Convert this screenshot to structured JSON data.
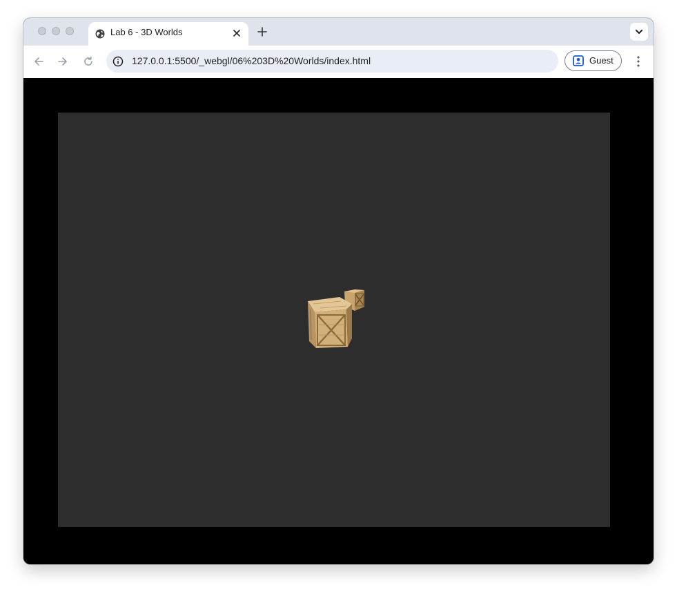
{
  "browser": {
    "tab": {
      "title": "Lab 6 - 3D Worlds",
      "favicon": "globe-icon",
      "close_icon": "close-icon"
    },
    "new_tab_icon": "plus-icon",
    "tab_search_icon": "chevron-down-icon",
    "nav": {
      "back_icon": "arrow-left-icon",
      "forward_icon": "arrow-right-icon",
      "reload_icon": "reload-icon"
    },
    "omnibox": {
      "site_info_icon": "info-icon",
      "url": "127.0.0.1:5500/_webgl/06%203D%20Worlds/index.html"
    },
    "profile": {
      "label": "Guest",
      "icon": "guest-profile-icon"
    },
    "menu_icon": "kebab-menu-icon"
  },
  "page": {
    "background": "#000000",
    "canvas": {
      "background": "#2d2d2d",
      "scene": "two wooden crates"
    }
  },
  "colors": {
    "titlebar": "#dfe3eb",
    "omnibox": "#e9eef6",
    "crate_wood": "#d2b07a"
  }
}
